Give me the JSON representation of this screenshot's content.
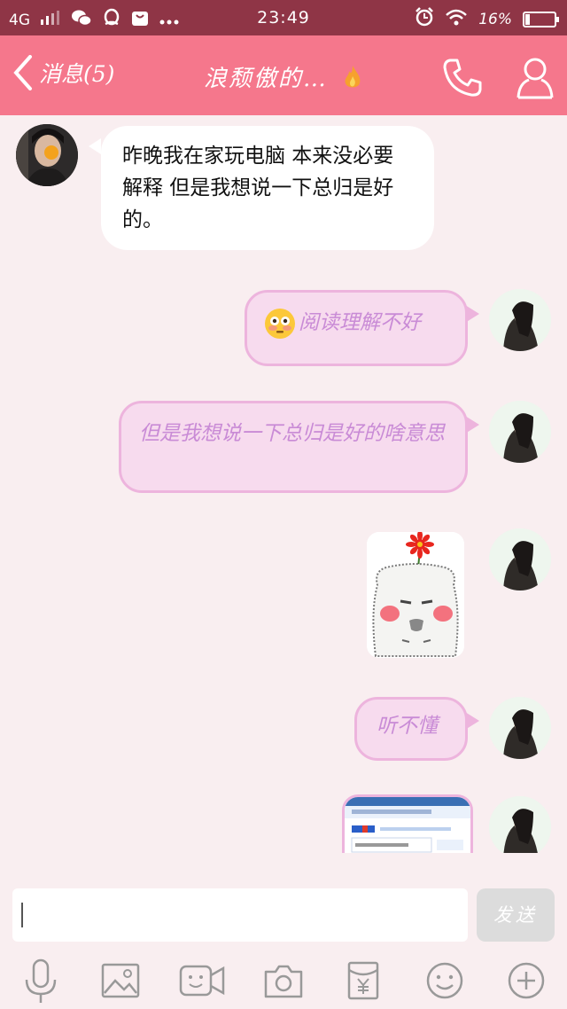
{
  "status_bar": {
    "network": "4G",
    "time": "23:49",
    "battery": "16%",
    "battery_level": 0.16
  },
  "header": {
    "back_label": "消息(5)",
    "title": "浪颓傲的…",
    "icons": [
      "back-chevron-icon",
      "fire-icon",
      "phone-icon",
      "profile-icon"
    ]
  },
  "messages": [
    {
      "from": "other",
      "type": "text",
      "text": "昨晚我在家玩电脑  本来没必要解释 但是我想说一下总归是好的。"
    },
    {
      "from": "me",
      "type": "text",
      "emoji": "flushed-face",
      "text": "阅读理解不好"
    },
    {
      "from": "me",
      "type": "text",
      "text": "但是我想说一下总归是好的啥意思"
    },
    {
      "from": "me",
      "type": "sticker",
      "sticker": "bun-face-with-flower"
    },
    {
      "from": "me",
      "type": "text",
      "text": "听不懂"
    },
    {
      "from": "me",
      "type": "image",
      "image": "search-app-screenshot"
    }
  ],
  "input": {
    "value": "",
    "send_label": "发送"
  },
  "toolbar": [
    "voice-icon",
    "image-icon",
    "video-icon",
    "camera-icon",
    "red-packet-icon",
    "emoji-icon",
    "plus-icon"
  ],
  "colors": {
    "status_bar": "#8f3546",
    "header": "#f5778c",
    "background": "#f9eef0",
    "my_bubble": "#f7dbee",
    "my_text": "#c98bd6"
  }
}
